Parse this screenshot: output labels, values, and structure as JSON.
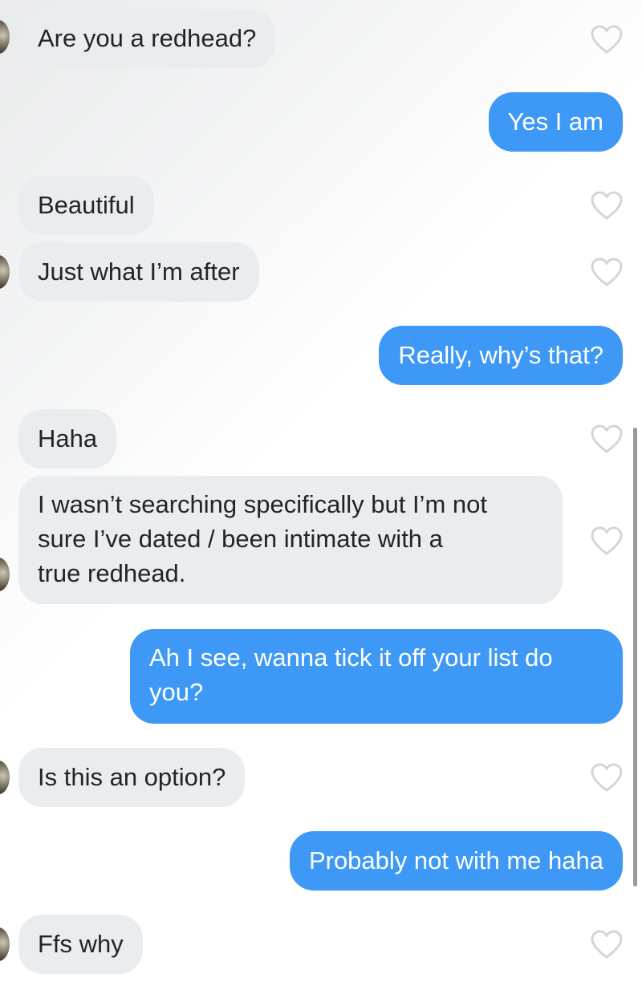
{
  "messages": [
    {
      "side": "in",
      "text": "Are you a redhead?"
    },
    {
      "side": "out",
      "text": "Yes I am"
    },
    {
      "side": "in",
      "text": "Beautiful"
    },
    {
      "side": "in",
      "text": "Just what I’m after"
    },
    {
      "side": "out",
      "text": "Really, why’s that?"
    },
    {
      "side": "in",
      "text": "Haha"
    },
    {
      "side": "in",
      "text": "I wasn’t searching specifically but I’m not sure I’ve dated / been intimate with a true redhead.",
      "lines": [
        "I wasn’t searching specifically but I’m not",
        "sure I’ve dated / been intimate with a",
        "true redhead."
      ]
    },
    {
      "side": "out",
      "text": "Ah I see, wanna tick it off your list do you?",
      "lines": [
        "Ah I see, wanna tick it off your list do",
        "you?"
      ]
    },
    {
      "side": "in",
      "text": "Is this an option?"
    },
    {
      "side": "out",
      "text": "Probably not with me haha"
    },
    {
      "side": "in",
      "text": "Ffs why"
    }
  ],
  "colors": {
    "incoming_bubble": "#e9edf0",
    "outgoing_bubble": "#3e99f6",
    "heart_outline": "#d2d6da"
  },
  "icons": {
    "like": "heart-outline-icon",
    "avatar": "avatar"
  }
}
